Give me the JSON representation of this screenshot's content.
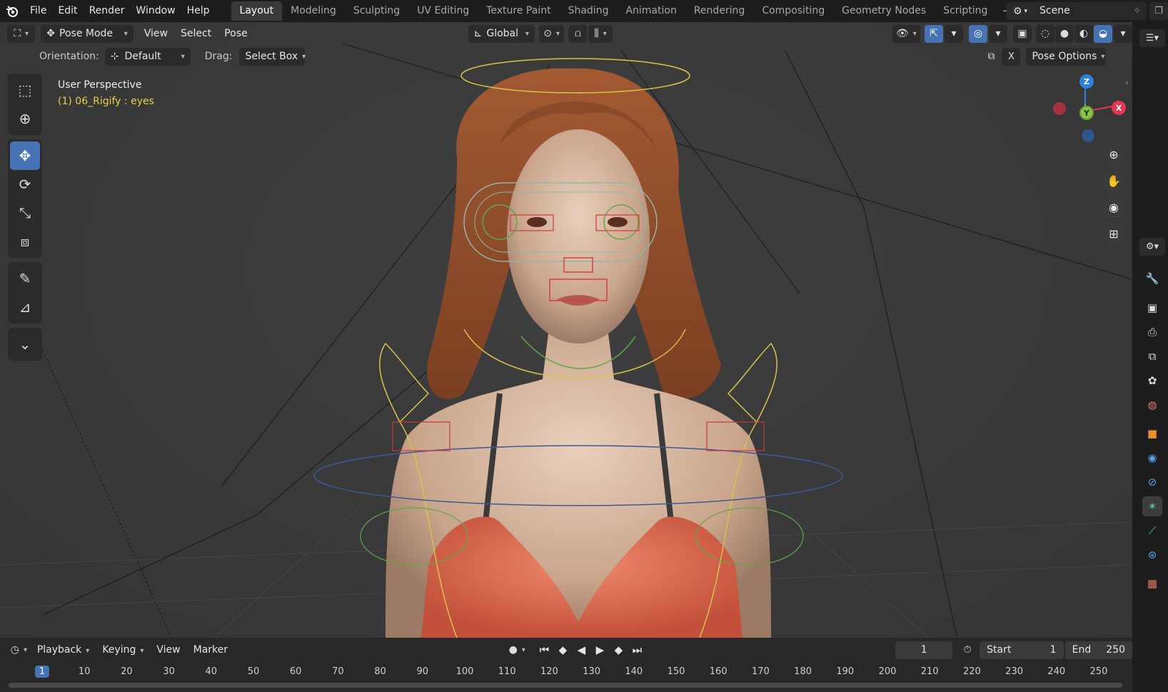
{
  "menu": {
    "items": [
      "File",
      "Edit",
      "Render",
      "Window",
      "Help"
    ]
  },
  "workspaces": {
    "tabs": [
      "Layout",
      "Modeling",
      "Sculpting",
      "UV Editing",
      "Texture Paint",
      "Shading",
      "Animation",
      "Rendering",
      "Compositing",
      "Geometry Nodes",
      "Scripting"
    ],
    "active": "Layout",
    "add_label": "+"
  },
  "scene": {
    "name": "Scene"
  },
  "viewport_header": {
    "mode": "Pose Mode",
    "menus": [
      "View",
      "Select",
      "Pose"
    ],
    "transform_orientation": "Global"
  },
  "tool_settings": {
    "orientation_label": "Orientation:",
    "orientation_value": "Default",
    "drag_label": "Drag:",
    "drag_value": "Select Box",
    "close_label": "X",
    "pose_options": "Pose Options"
  },
  "viewport": {
    "view_name": "User Perspective",
    "object_info": "(1) 06_Rigify : eyes"
  },
  "gizmo": {
    "z": "Z",
    "x": "X",
    "y": "Y"
  },
  "timeline": {
    "menus": [
      "Playback",
      "Keying",
      "View",
      "Marker"
    ],
    "current_frame": "1",
    "start_label": "Start",
    "start_value": "1",
    "end_label": "End",
    "end_value": "250",
    "ruler": [
      "1",
      "10",
      "20",
      "30",
      "40",
      "50",
      "60",
      "70",
      "80",
      "90",
      "100",
      "110",
      "120",
      "130",
      "140",
      "150",
      "160",
      "170",
      "180",
      "190",
      "200",
      "210",
      "220",
      "230",
      "240",
      "250"
    ]
  },
  "colors": {
    "accent": "#4772b3",
    "axis_x": "#e5364d",
    "axis_y": "#8bc34a",
    "axis_z": "#2f80d8",
    "object_info": "#e8d04a"
  }
}
